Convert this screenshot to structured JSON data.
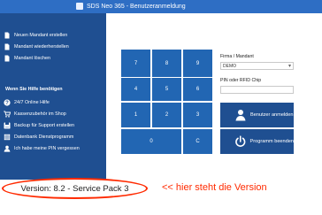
{
  "window": {
    "title": "SDS Neo 365 - Benutzeranmeldung"
  },
  "sidebar": {
    "top_items": [
      {
        "label": "Neuen Mandant erstellen",
        "icon": "document-icon"
      },
      {
        "label": "Mandant wiederherstellen",
        "icon": "document-icon"
      },
      {
        "label": "Mandant löschen",
        "icon": "document-icon"
      }
    ],
    "heading": "Wenn Sie Hilfe benötigen",
    "help_items": [
      {
        "label": "24/7 Online Hilfe",
        "icon": "help-icon"
      },
      {
        "label": "Kassenzubehör im Shop",
        "icon": "cart-icon"
      },
      {
        "label": "Backup für Support erstellen",
        "icon": "backup-icon"
      },
      {
        "label": "Datenbank Dienstprogramm",
        "icon": "database-icon"
      },
      {
        "label": "Ich habe meine PIN vergessen",
        "icon": "user-icon"
      }
    ]
  },
  "keypad": {
    "keys": [
      "7",
      "8",
      "9",
      "4",
      "5",
      "6",
      "1",
      "2",
      "3",
      "0",
      "C"
    ]
  },
  "form": {
    "company_label": "Firma / Mandant",
    "company_value": "DEMO",
    "pin_label": "PIN oder RFID Chip",
    "pin_value": ""
  },
  "buttons": {
    "login": "Benutzer anmelden",
    "exit": "Programm beenden"
  },
  "footer": {
    "version": "Version: 8.2 - Service Pack 3",
    "annotation": "<< hier steht die Version"
  },
  "colors": {
    "titlebar": "#2e6ec4",
    "sidebar": "#1f4f91",
    "keypad": "#2266b3",
    "annotation": "#ff2a00"
  }
}
